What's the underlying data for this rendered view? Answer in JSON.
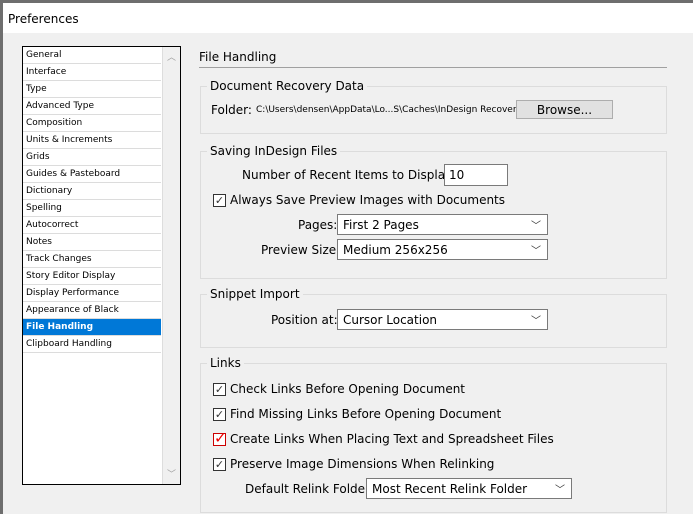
{
  "window": {
    "title": "Preferences"
  },
  "sidebar": {
    "items": [
      "General",
      "Interface",
      "Type",
      "Advanced Type",
      "Composition",
      "Units & Increments",
      "Grids",
      "Guides & Pasteboard",
      "Dictionary",
      "Spelling",
      "Autocorrect",
      "Notes",
      "Track Changes",
      "Story Editor Display",
      "Display Performance",
      "Appearance of Black",
      "File Handling",
      "Clipboard Handling"
    ],
    "selected": "File Handling",
    "selected_color": "#0078d7"
  },
  "main": {
    "title": "File Handling",
    "recovery": {
      "label": "Document Recovery Data",
      "folder_label": "Folder:",
      "folder_path": "C:\\Users\\densen\\AppData\\Lo...S\\Caches\\InDesign Recovery",
      "browse": "Browse..."
    },
    "saving": {
      "label": "Saving InDesign Files",
      "recent_label": "Number of Recent Items to Display:",
      "recent_value": "10",
      "preview_label": "Always Save Preview Images with Documents",
      "preview_checked": true,
      "pages_label": "Pages:",
      "pages_value": "First 2 Pages",
      "size_label": "Preview Size:",
      "size_value": "Medium 256x256"
    },
    "snippet": {
      "label": "Snippet Import",
      "position_label": "Position at:",
      "position_value": "Cursor Location"
    },
    "links": {
      "label": "Links",
      "options": [
        {
          "label": "Check Links Before Opening Document",
          "checked": true
        },
        {
          "label": "Find Missing Links Before Opening Document",
          "checked": true
        },
        {
          "label": "Create Links When Placing Text and Spreadsheet Files",
          "checked": true,
          "highlight": "red"
        },
        {
          "label": "Preserve Image Dimensions When Relinking",
          "checked": true
        }
      ],
      "relink_label": "Default Relink Folder:",
      "relink_value": "Most Recent Relink Folder"
    }
  }
}
